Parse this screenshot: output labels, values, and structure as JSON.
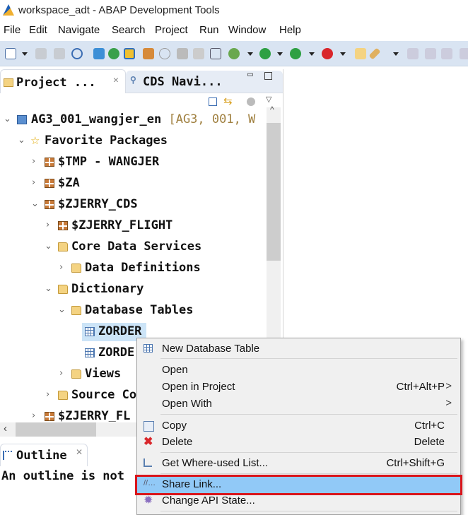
{
  "window": {
    "title": "workspace_adt - ABAP Development Tools"
  },
  "menubar": [
    "File",
    "Edit",
    "Navigate",
    "Search",
    "Project",
    "Run",
    "Window",
    "Help"
  ],
  "tabs": {
    "project": "Project ...",
    "cds": "CDS Navi...",
    "outline": "Outline"
  },
  "tree": [
    {
      "label": "AG3_001_wangjer_en",
      "suffix": " [AG3, 001, W",
      "icon": "abap-project-icon",
      "state": "open"
    },
    {
      "label": "Favorite Packages",
      "icon": "star-icon",
      "state": "open"
    },
    {
      "label": "$TMP - WANGJER",
      "icon": "package-icon",
      "state": "closed"
    },
    {
      "label": "$ZA",
      "icon": "package-icon",
      "state": "closed"
    },
    {
      "label": "$ZJERRY_CDS",
      "icon": "package-icon",
      "state": "open"
    },
    {
      "label": "$ZJERRY_FLIGHT",
      "icon": "package-icon",
      "state": "closed"
    },
    {
      "label": "Core Data Services",
      "icon": "folder-icon",
      "state": "open"
    },
    {
      "label": "Data Definitions",
      "icon": "folder-icon",
      "state": "closed"
    },
    {
      "label": "Dictionary",
      "icon": "folder-icon",
      "state": "open"
    },
    {
      "label": "Database Tables",
      "icon": "folder-icon",
      "state": "open"
    },
    {
      "label": "ZORDER",
      "icon": "table-icon",
      "state": "leaf",
      "selected": true
    },
    {
      "label": "ZORDE",
      "icon": "table-icon",
      "state": "leaf"
    },
    {
      "label": "Views",
      "icon": "folder-icon",
      "state": "closed"
    },
    {
      "label": "Source Co",
      "icon": "folder-icon",
      "state": "closed"
    },
    {
      "label": "$ZJERRY_FL",
      "icon": "package-icon",
      "state": "closed"
    }
  ],
  "outline": {
    "message": "An outline is not"
  },
  "context_menu": [
    {
      "label": "New Database Table",
      "shortcut": "",
      "icon": "new-table-icon"
    },
    {
      "label": "Open",
      "shortcut": ""
    },
    {
      "label": "Open in Project",
      "shortcut": "Ctrl+Alt+P",
      "submenu": ">"
    },
    {
      "label": "Open With",
      "shortcut": "",
      "submenu": ">"
    },
    {
      "label": "Copy",
      "shortcut": "Ctrl+C",
      "icon": "copy-icon"
    },
    {
      "label": "Delete",
      "shortcut": "Delete",
      "icon": "delete-icon"
    },
    {
      "label": "Get Where-used List...",
      "shortcut": "Ctrl+Shift+G",
      "icon": "where-used-icon"
    },
    {
      "label": "Share Link...",
      "shortcut": "",
      "icon": "share-link-icon",
      "highlighted": true
    },
    {
      "label": "Change API State...",
      "shortcut": "",
      "icon": "gear-icon"
    }
  ]
}
